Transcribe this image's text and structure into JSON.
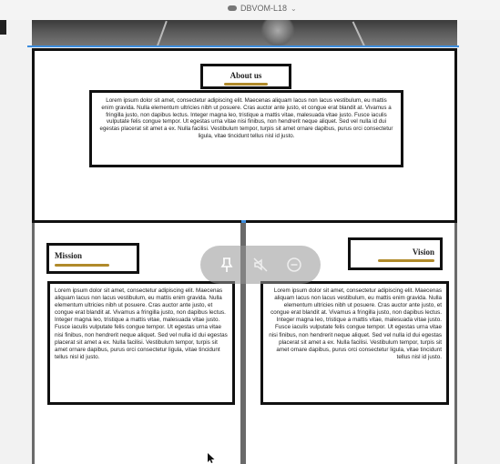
{
  "window": {
    "title": "DBVOM-L18"
  },
  "about": {
    "heading": "About us",
    "body": "Lorem ipsum dolor sit amet, consectetur adipiscing elit. Maecenas aliquam lacus non lacus vestibulum, eu mattis enim gravida. Nulla elementum ultricies nibh ut posuere. Cras auctor ante justo, et congue erat blandit at. Vivamus a fringilla justo, non dapibus lectus. Integer magna leo, tristique a mattis vitae, malesuada vitae justo. Fusce iaculis vulputate felis congue tempor. Ut egestas urna vitae nisi finibus, non hendrerit neque aliquet. Sed vel nulla id dui egestas placerat sit amet a ex. Nulla facilisi. Vestibulum tempor, turpis sit amet ornare dapibus, purus orci consectetur ligula, vitae tincidunt tellus nisl id justo."
  },
  "mission": {
    "heading": "Mission",
    "body": "Lorem ipsum dolor sit amet, consectetur adipiscing elit. Maecenas aliquam lacus non lacus vestibulum, eu mattis enim gravida. Nulla elementum ultricies nibh ut posuere. Cras auctor ante justo, et congue erat blandit at. Vivamus a fringilla justo, non dapibus lectus. Integer magna leo, tristique a mattis vitae, malesuada vitae justo. Fusce iaculis vulputate felis congue tempor. Ut egestas urna vitae nisi finibus, non hendrerit neque aliquet. Sed vel nulla id dui egestas placerat sit amet a ex. Nulla facilisi. Vestibulum tempor, turpis sit amet ornare dapibus, purus orci consectetur ligula, vitae tincidunt tellus nisl id justo."
  },
  "vision": {
    "heading": "Vision",
    "body": "Lorem ipsum dolor sit amet, consectetur adipiscing elit. Maecenas aliquam lacus non lacus vestibulum, eu mattis enim gravida. Nulla elementum ultricies nibh ut posuere. Cras auctor ante justo, et congue erat blandit at. Vivamus a fringilla justo, non dapibus lectus. Integer magna leo, tristique a mattis vitae, malesuada vitae justo. Fusce iaculis vulputate felis congue tempor. Ut egestas urna vitae nisi finibus, non hendrerit neque aliquet. Sed vel nulla id dui egestas placerat sit amet a ex. Nulla facilisi. Vestibulum tempor, turpis sit amet ornare dapibus, purus orci consectetur ligula, vitae tincidunt tellus nisl id justo."
  },
  "floating_toolbar": {
    "icons": [
      "pin-icon",
      "mic-muted-icon",
      "minus-circle-icon"
    ]
  },
  "colors": {
    "accent_gold": "#b08a2a",
    "selection_blue": "#3c8dde",
    "border": "#111111"
  }
}
